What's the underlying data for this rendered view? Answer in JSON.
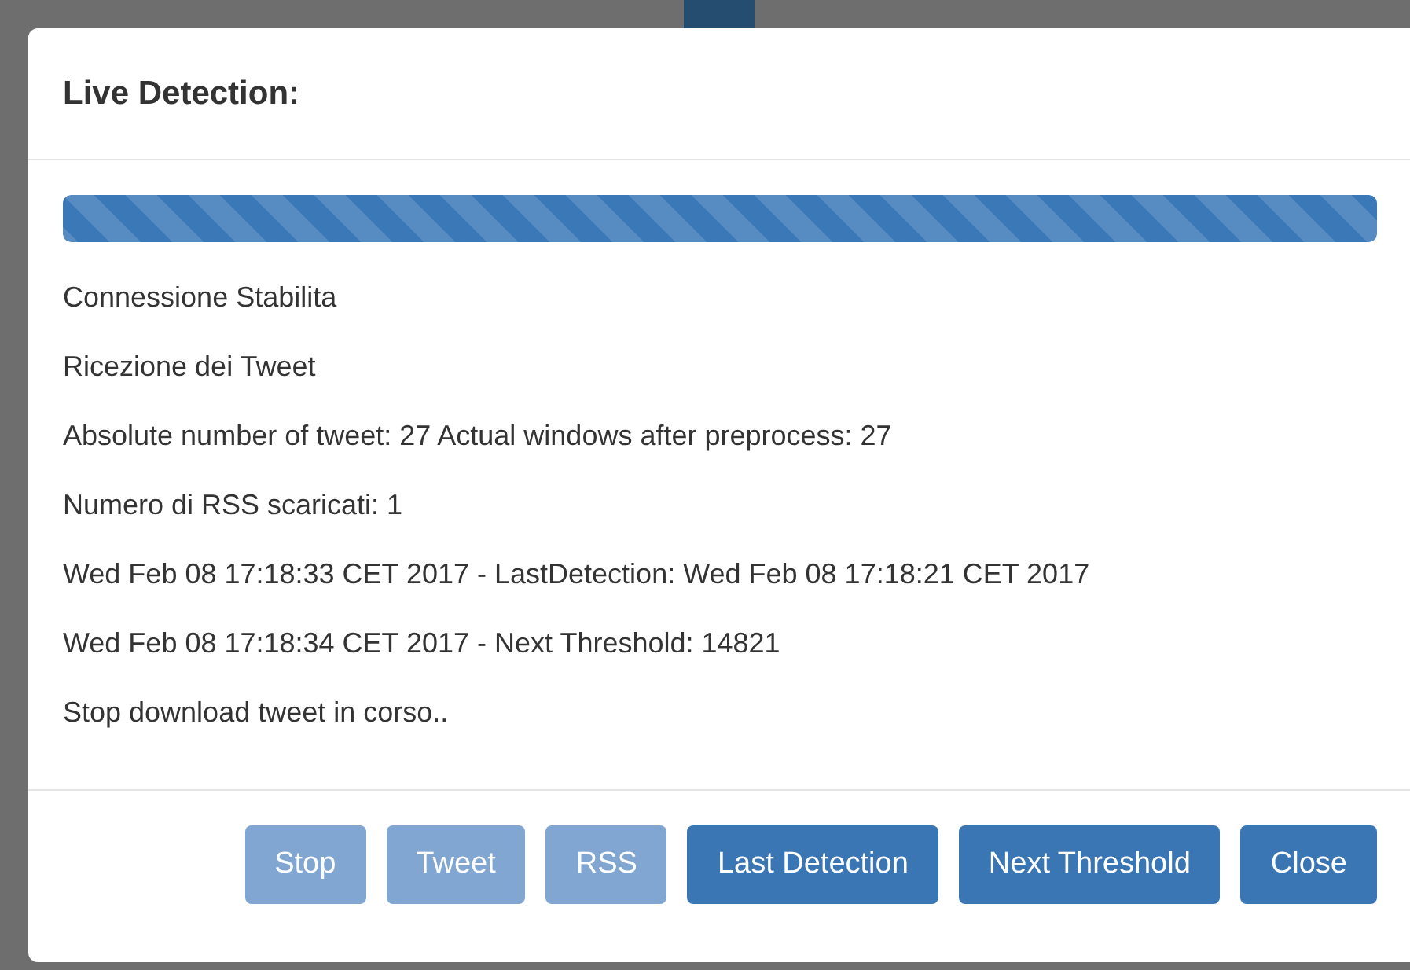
{
  "modal": {
    "title": "Live Detection:"
  },
  "progress": {
    "level": 1
  },
  "messages": [
    "Connessione Stabilita",
    "Ricezione dei Tweet",
    "Absolute number of tweet: 27 Actual windows after preprocess: 27",
    "Numero di RSS scaricati: 1",
    "Wed Feb 08 17:18:33 CET 2017 - LastDetection: Wed Feb 08 17:18:21 CET 2017",
    "Wed Feb 08 17:18:34 CET 2017 - Next Threshold: 14821",
    "Stop download tweet in corso.."
  ],
  "buttons": [
    {
      "label": "Stop",
      "disabled": true
    },
    {
      "label": "Tweet",
      "disabled": true
    },
    {
      "label": "RSS",
      "disabled": true
    },
    {
      "label": "Last Detection",
      "disabled": false
    },
    {
      "label": "Next Threshold",
      "disabled": false
    },
    {
      "label": "Close",
      "disabled": false
    }
  ]
}
